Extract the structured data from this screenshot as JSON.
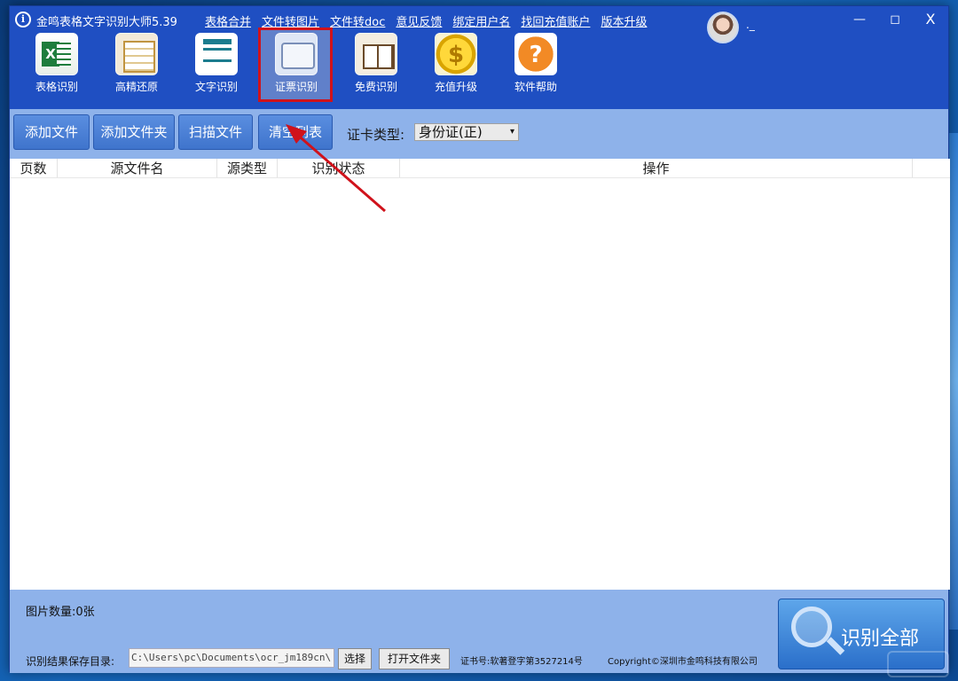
{
  "app": {
    "title": "金鸣表格文字识别大师5.39",
    "logo_glyph": "i",
    "user_name": "._"
  },
  "top_menu": [
    "表格合并",
    "文件转图片",
    "文件转doc",
    "意见反馈",
    "绑定用户名",
    "找回充值账户",
    "版本升级"
  ],
  "window_controls": {
    "minimize": "—",
    "maximize": "◻",
    "close": "X"
  },
  "toolbar": [
    {
      "label": "表格识别",
      "icon": "excel-icon"
    },
    {
      "label": "高精还原",
      "icon": "document-layout-icon"
    },
    {
      "label": "文字识别",
      "icon": "text-document-icon"
    },
    {
      "label": "证票识别",
      "icon": "id-card-icon",
      "active": true
    },
    {
      "label": "免费识别",
      "icon": "book-icon"
    },
    {
      "label": "充值升级",
      "icon": "dollar-coin-icon",
      "glyph": "$"
    },
    {
      "label": "软件帮助",
      "icon": "help-icon",
      "glyph": "?"
    }
  ],
  "actions": {
    "add_file": "添加文件",
    "add_folder": "添加文件夹",
    "scan_file": "扫描文件",
    "clear_list": "清空列表"
  },
  "card_type": {
    "label": "证卡类型:",
    "selected": "身份证(正)"
  },
  "table": {
    "columns": [
      "页数",
      "源文件名",
      "源类型",
      "识别状态",
      "操作"
    ],
    "rows": []
  },
  "bottom": {
    "image_count": "图片数量:0张",
    "save_dir_label": "识别结果保存目录:",
    "save_path": "C:\\Users\\pc\\Documents\\ocr_jm189cn\\",
    "choose_button": "选择",
    "open_folder_button": "打开文件夹",
    "cert_no": "证书号:软著登字第3527214号",
    "copyright": "Copyright©深圳市金鸣科技有限公司",
    "recognize_all": "识别全部"
  },
  "colors": {
    "window_bg": "#1f4fc2",
    "panel_bg": "#8eb2ea",
    "highlight_frame": "#d0121b",
    "annotation_arrow": "#d0121b"
  }
}
